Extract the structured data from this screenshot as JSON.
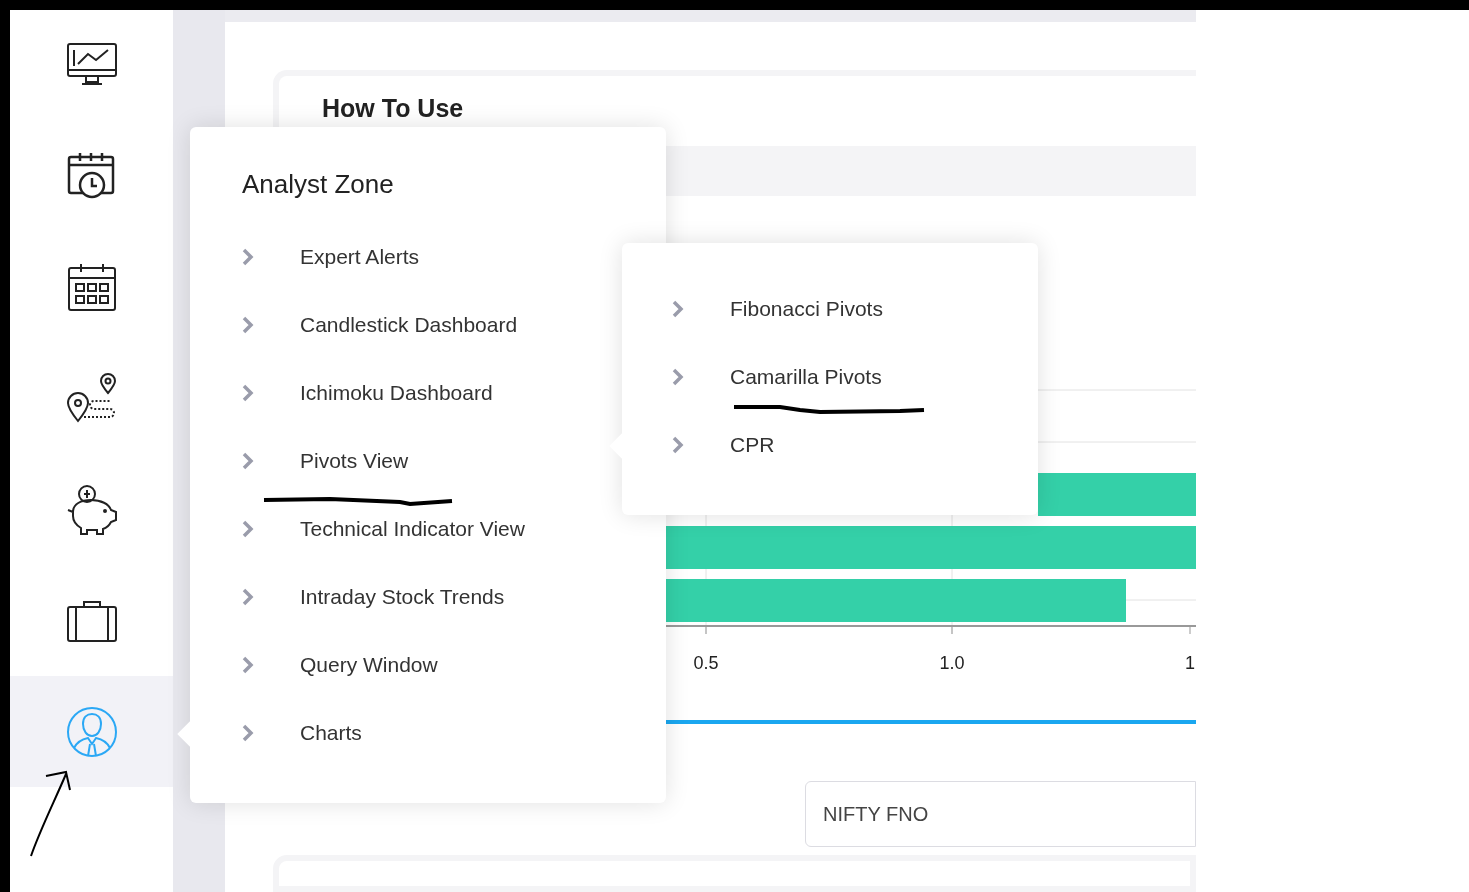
{
  "sidebar": {
    "items": [
      {
        "selected": false
      },
      {
        "selected": false
      },
      {
        "selected": false
      },
      {
        "selected": false
      },
      {
        "selected": false
      },
      {
        "selected": false
      },
      {
        "selected": true
      }
    ]
  },
  "main": {
    "how_to_use": "How To Use",
    "axis_labels": [
      "0.5",
      "1.0",
      "1"
    ],
    "market_select": "NIFTY FNO"
  },
  "menu": {
    "title": "Analyst Zone",
    "items": [
      "Expert Alerts",
      "Candlestick Dashboard",
      "Ichimoku Dashboard",
      "Pivots View",
      "Technical Indicator View",
      "Intraday Stock Trends",
      "Query Window",
      "Charts"
    ]
  },
  "submenu": {
    "items": [
      "Fibonacci Pivots",
      "Camarilla Pivots",
      "CPR"
    ]
  }
}
